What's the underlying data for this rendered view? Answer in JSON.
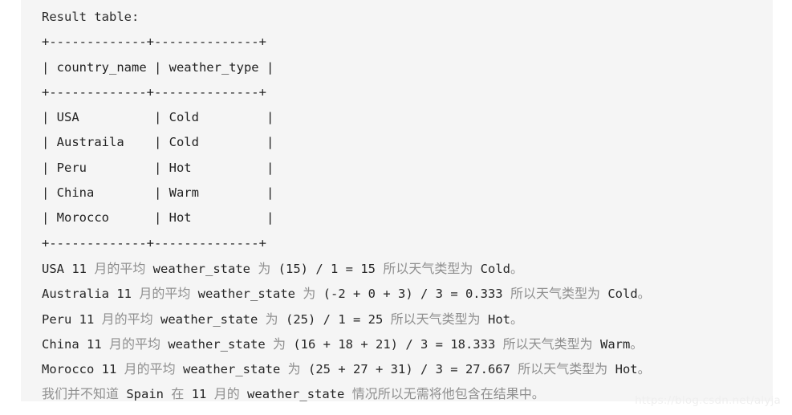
{
  "page": {
    "background_color": "#ffffff",
    "code_block_color": "#f5f5f5"
  },
  "code_block": {
    "heading": "Result table:",
    "table_ascii": {
      "top_border": "+-------------+--------------+",
      "header_row": "| country_name | weather_type |",
      "header_separator": "+-------------+--------------+",
      "bottom_border": "+-------------+--------------+",
      "columns": [
        "country_name",
        "weather_type"
      ],
      "rows": [
        {
          "country_name": "USA",
          "weather_type": "Cold",
          "line": "| USA          | Cold         |"
        },
        {
          "country_name": "Austraila",
          "weather_type": "Cold",
          "line": "| Austraila    | Cold         |"
        },
        {
          "country_name": "Peru",
          "weather_type": "Hot",
          "line": "| Peru         | Hot          |"
        },
        {
          "country_name": "China",
          "weather_type": "Warm",
          "line": "| China        | Warm         |"
        },
        {
          "country_name": "Morocco",
          "weather_type": "Hot",
          "line": "| Morocco      | Hot          |"
        }
      ]
    },
    "explanations": [
      {
        "country": "USA",
        "segments": [
          {
            "type": "latin",
            "text": "USA 11 "
          },
          {
            "type": "cjk",
            "text": "月的平均"
          },
          {
            "type": "latin",
            "text": " weather_state "
          },
          {
            "type": "cjk",
            "text": "为"
          },
          {
            "type": "latin",
            "text": " (15) / 1 = 15 "
          },
          {
            "type": "cjk",
            "text": "所以天气类型为"
          },
          {
            "type": "latin",
            "text": " Cold"
          },
          {
            "type": "cjk",
            "text": "。"
          }
        ]
      },
      {
        "country": "Australia",
        "segments": [
          {
            "type": "latin",
            "text": "Australia 11 "
          },
          {
            "type": "cjk",
            "text": "月的平均"
          },
          {
            "type": "latin",
            "text": " weather_state "
          },
          {
            "type": "cjk",
            "text": "为"
          },
          {
            "type": "latin",
            "text": " (-2 + 0 + 3) / 3 = 0.333 "
          },
          {
            "type": "cjk",
            "text": "所以天气类型为"
          },
          {
            "type": "latin",
            "text": " Cold"
          },
          {
            "type": "cjk",
            "text": "。"
          }
        ]
      },
      {
        "country": "Peru",
        "segments": [
          {
            "type": "latin",
            "text": "Peru 11 "
          },
          {
            "type": "cjk",
            "text": "月的平均"
          },
          {
            "type": "latin",
            "text": " weather_state "
          },
          {
            "type": "cjk",
            "text": "为"
          },
          {
            "type": "latin",
            "text": " (25) / 1 = 25 "
          },
          {
            "type": "cjk",
            "text": "所以天气类型为"
          },
          {
            "type": "latin",
            "text": " Hot"
          },
          {
            "type": "cjk",
            "text": "。"
          }
        ]
      },
      {
        "country": "China",
        "segments": [
          {
            "type": "latin",
            "text": "China 11 "
          },
          {
            "type": "cjk",
            "text": "月的平均"
          },
          {
            "type": "latin",
            "text": " weather_state "
          },
          {
            "type": "cjk",
            "text": "为"
          },
          {
            "type": "latin",
            "text": " (16 + 18 + 21) / 3 = 18.333 "
          },
          {
            "type": "cjk",
            "text": "所以天气类型为"
          },
          {
            "type": "latin",
            "text": " Warm"
          },
          {
            "type": "cjk",
            "text": "。"
          }
        ]
      },
      {
        "country": "Morocco",
        "segments": [
          {
            "type": "latin",
            "text": "Morocco 11 "
          },
          {
            "type": "cjk",
            "text": "月的平均"
          },
          {
            "type": "latin",
            "text": " weather_state "
          },
          {
            "type": "cjk",
            "text": "为"
          },
          {
            "type": "latin",
            "text": " (25 + 27 + 31) / 3 = 27.667 "
          },
          {
            "type": "cjk",
            "text": "所以天气类型为"
          },
          {
            "type": "latin",
            "text": " Hot"
          },
          {
            "type": "cjk",
            "text": "。"
          }
        ]
      },
      {
        "country": "Spain",
        "segments": [
          {
            "type": "cjk",
            "text": "我们并不知道"
          },
          {
            "type": "latin",
            "text": " Spain "
          },
          {
            "type": "cjk",
            "text": "在"
          },
          {
            "type": "latin",
            "text": " 11 "
          },
          {
            "type": "cjk",
            "text": "月的"
          },
          {
            "type": "latin",
            "text": " weather_state "
          },
          {
            "type": "cjk",
            "text": "情况所以无需将他包含在结果中。"
          }
        ]
      }
    ]
  },
  "watermark": {
    "text": "https://blog.csdn.net/alyja"
  }
}
